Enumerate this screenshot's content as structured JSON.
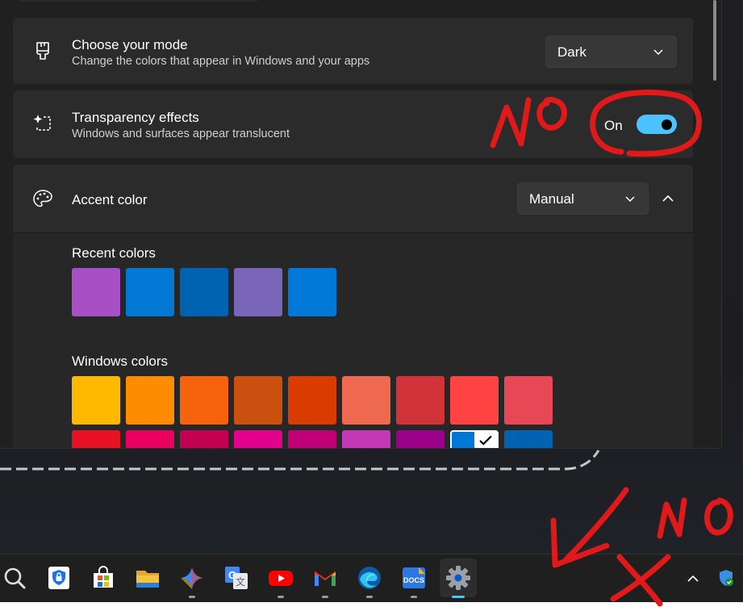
{
  "mode_card": {
    "title": "Choose your mode",
    "subtitle": "Change the colors that appear in Windows and your apps",
    "dropdown_value": "Dark",
    "icon": "paintbrush-icon"
  },
  "transparency_card": {
    "title": "Transparency effects",
    "subtitle": "Windows and surfaces appear translucent",
    "toggle_label": "On",
    "toggle_on": true,
    "icon": "sparkle-frame-icon"
  },
  "accent_card": {
    "title": "Accent color",
    "dropdown_value": "Manual",
    "icon": "palette-icon",
    "expanded": true,
    "recent_label": "Recent colors",
    "recent_colors": [
      "#a94fc6",
      "#0078d4",
      "#0063b1",
      "#7a66b9",
      "#0078d7"
    ],
    "windows_label": "Windows colors",
    "windows_colors_row1": [
      "#ffb900",
      "#ff8c00",
      "#f7630c",
      "#ca5010",
      "#da3b01",
      "#ef6950",
      "#d13438",
      "#ff4343",
      "#e74856"
    ],
    "windows_colors_row2": [
      "#e81123",
      "#ea005e",
      "#c30052",
      "#e3008c",
      "#bf0077",
      "#c239b3",
      "#9a0089",
      "#0078d7",
      "#0063b1"
    ],
    "selected_index_row2": 7
  },
  "taskbar": {
    "icons": [
      {
        "name": "search-icon",
        "color": "#e0e0e0"
      },
      {
        "name": "password-manager-icon",
        "color": "#1a73e8"
      },
      {
        "name": "store-icon",
        "color": "#0078d4"
      },
      {
        "name": "file-explorer-icon",
        "color": "#f5c242"
      },
      {
        "name": "gemini-icon",
        "color": "#4285f4"
      },
      {
        "name": "translate-icon",
        "color": "#4285f4"
      },
      {
        "name": "youtube-icon",
        "color": "#ff0000"
      },
      {
        "name": "gmail-icon",
        "color": "#ea4335"
      },
      {
        "name": "edge-icon",
        "color": "#0c59a4"
      },
      {
        "name": "docs-icon",
        "color": "#2b78e4"
      },
      {
        "name": "settings-icon",
        "color": "#9aa0a6"
      }
    ],
    "docs_label": "DOCS",
    "tray": [
      "chevron-up-icon",
      "security-shield-icon"
    ]
  },
  "annotations": {
    "text_top": "NO",
    "text_bottom": "NO",
    "color": "#e0191b"
  }
}
